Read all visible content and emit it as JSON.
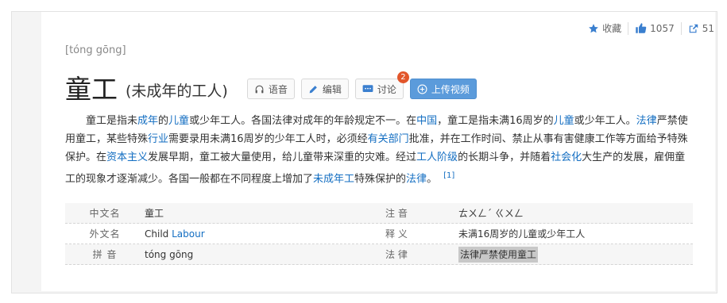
{
  "topbar": {
    "favorite_label": "收藏",
    "like_count": "1057",
    "share_count": "51"
  },
  "entry": {
    "pinyin": "[tóng gōng]",
    "title": "童工",
    "subtitle": "(未成年的工人)"
  },
  "buttons": {
    "voice": "语音",
    "edit": "编辑",
    "discuss": "讨论",
    "discuss_badge": "2",
    "upload_video": "上传视频"
  },
  "paragraph": {
    "s1": "童工是指未",
    "l1": "成年",
    "s2": "的",
    "l2": "儿童",
    "s3": "或少年工人。各国法律对成年的年龄规定不一。在",
    "l3": "中国",
    "s4": "，童工是指未满16周岁的",
    "l4": "儿童",
    "s5": "或少年工人。",
    "l5": "法律",
    "s6": "严禁使用童工，某些特殊",
    "l6": "行业",
    "s7": "需要录用未满16周岁的少年工人时，必须经",
    "l7": "有关部门",
    "s8": "批准，并在工作时间、禁止从事有害健康工作等方面给予特殊保护。在",
    "l8": "资本主义",
    "s9": "发展早期，童工被大量使用，给儿童带来深重的灾难。经过",
    "l9": "工人阶级",
    "s10": "的长期斗争，并随着",
    "l10": "社会化",
    "s11": "大生产的发展，雇佣童工的现象才逐渐减少。各国一般都在不同程度上增加了",
    "l11": "未成年工",
    "s12": "特殊保护的",
    "l12": "法律",
    "s13": "。",
    "ref": "[1]"
  },
  "info": {
    "chinese_name_label": "中文名",
    "chinese_name": "童工",
    "zhuyin_label": "注 音",
    "zhuyin": "ㄊㄨㄥˊ ㄍㄨㄥ",
    "foreign_name_label": "外文名",
    "foreign_name_a": "Child ",
    "foreign_name_b": "Labour",
    "meaning_label": "释 义",
    "meaning": "未满16周岁的儿童或少年工人",
    "pinyin_label": "拼 音",
    "pinyin": "tóng gōng",
    "law_label": "法 律",
    "law": "法律严禁使用童工"
  },
  "colors": {
    "link": "#136ec2",
    "accent": "#5b9bdb",
    "badge": "#e2562b"
  }
}
